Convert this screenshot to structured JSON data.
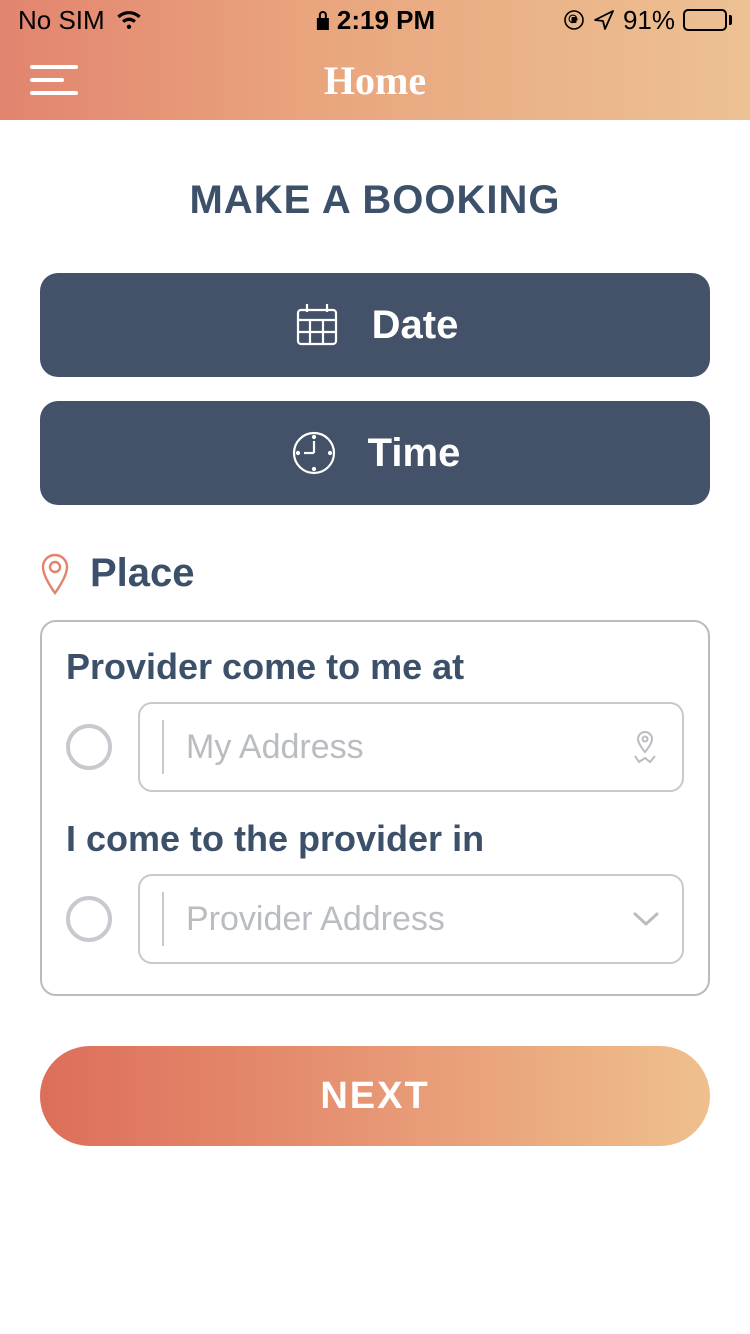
{
  "status": {
    "carrier": "No SIM",
    "time": "2:19 PM",
    "battery_pct": "91%"
  },
  "nav": {
    "title": "Home"
  },
  "page": {
    "title": "MAKE A BOOKING"
  },
  "buttons": {
    "date": "Date",
    "time": "Time"
  },
  "place": {
    "header": "Place",
    "option1_label": "Provider come to me at",
    "option1_placeholder": "My Address",
    "option2_label": "I come to the provider in",
    "option2_placeholder": "Provider Address"
  },
  "footer": {
    "next": "NEXT"
  }
}
